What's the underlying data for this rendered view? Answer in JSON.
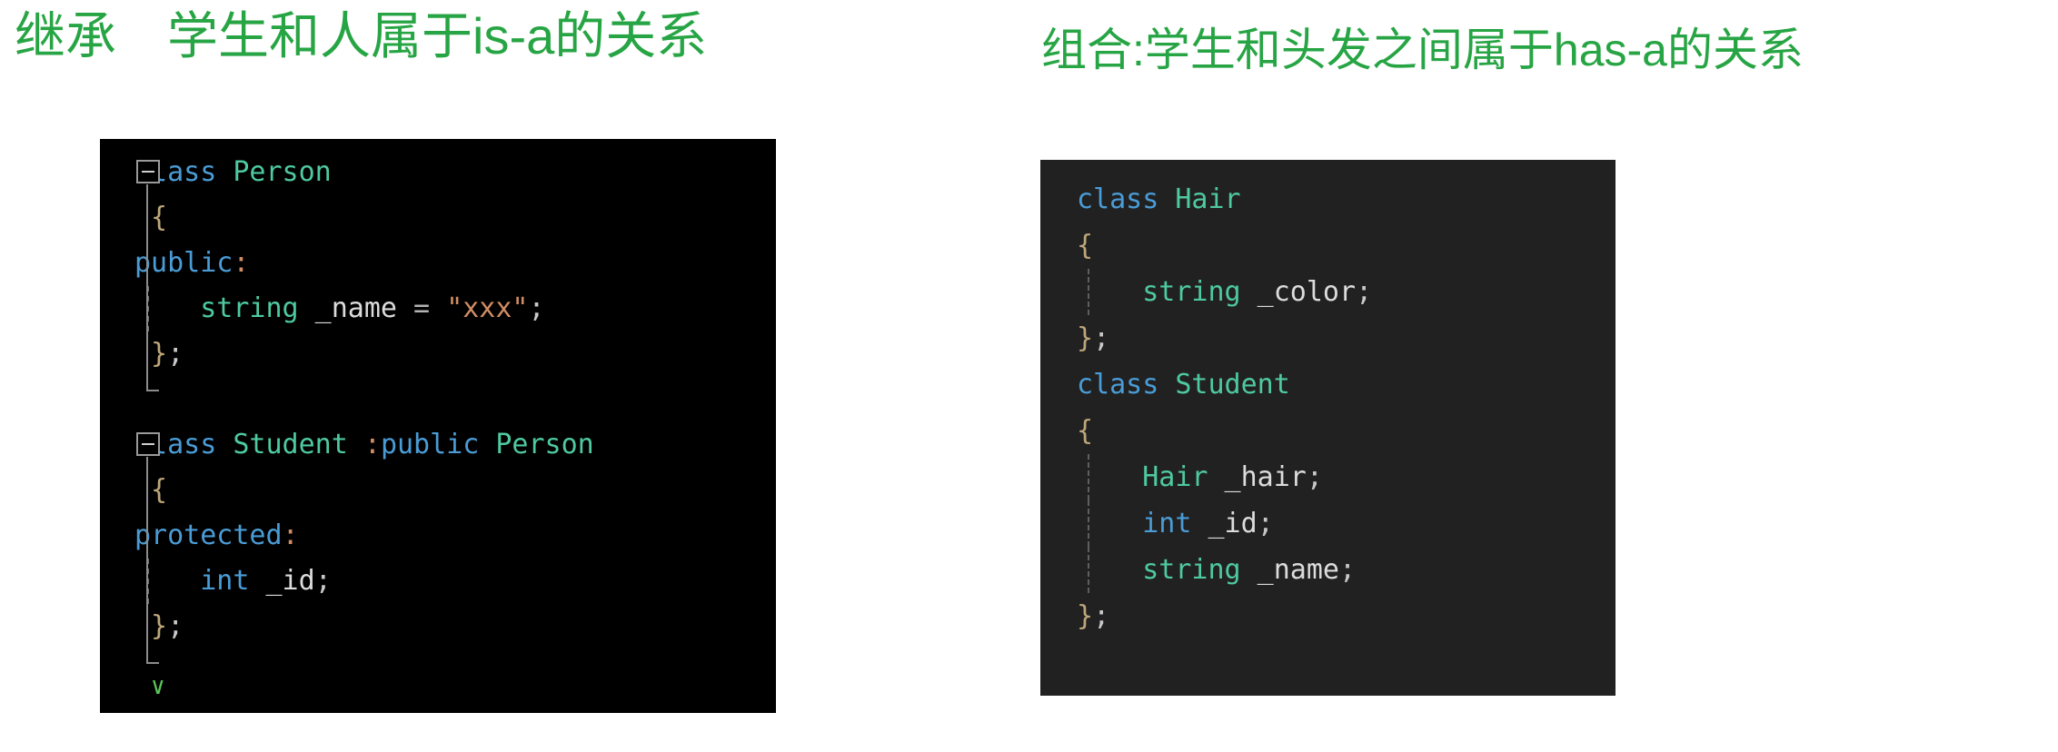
{
  "headings": {
    "left": "继承　学生和人属于is-a的关系",
    "right": "组合:学生和头发之间属于has-a的关系",
    "color": "#27a544"
  },
  "theme": {
    "left_panel_background": "#000000",
    "right_panel_background": "#212121",
    "keyword_color": "#4a9cd6",
    "type_color": "#4ec9a0",
    "identifier_color": "#dcdcdc",
    "string_color": "#d18d63",
    "brace_color": "#bda67a",
    "outline_color": "#8c8c8c",
    "squiggle_color": "#5ac35a"
  },
  "left_code": {
    "language": "cpp",
    "lines": [
      {
        "collapse": "minus",
        "tokens": [
          {
            "t": "class ",
            "c": "kw"
          },
          {
            "t": "Person",
            "c": "type"
          }
        ]
      },
      {
        "tokens": [
          {
            "t": " {",
            "c": "brace"
          }
        ]
      },
      {
        "tokens": [
          {
            "t": "public",
            "c": "kw"
          },
          {
            "t": ":",
            "c": "colon"
          }
        ]
      },
      {
        "indent_guide": true,
        "tokens": [
          {
            "t": "    string",
            "c": "type"
          },
          {
            "t": " _name",
            "c": "ident"
          },
          {
            "t": " = ",
            "c": "op"
          },
          {
            "t": "\"xxx\"",
            "c": "str"
          },
          {
            "t": ";",
            "c": "punct"
          }
        ]
      },
      {
        "tokens": [
          {
            "t": " }",
            "c": "brace"
          },
          {
            "t": ";",
            "c": "punct"
          }
        ]
      },
      {
        "tokens": [
          {
            "t": "",
            "c": "punct"
          }
        ]
      },
      {
        "collapse": "minus",
        "tokens": [
          {
            "t": "class ",
            "c": "kw"
          },
          {
            "t": "Student",
            "c": "type"
          },
          {
            "t": " :",
            "c": "colon"
          },
          {
            "t": "public",
            "c": "kw"
          },
          {
            "t": " ",
            "c": "punct"
          },
          {
            "t": "Person",
            "c": "type"
          }
        ]
      },
      {
        "tokens": [
          {
            "t": " {",
            "c": "brace"
          }
        ]
      },
      {
        "tokens": [
          {
            "t": "protected",
            "c": "kw"
          },
          {
            "t": ":",
            "c": "colon"
          }
        ]
      },
      {
        "indent_guide": true,
        "tokens": [
          {
            "t": "    int",
            "c": "kw"
          },
          {
            "t": " _id",
            "c": "ident"
          },
          {
            "t": ";",
            "c": "punct"
          }
        ]
      },
      {
        "tokens": [
          {
            "t": " }",
            "c": "brace"
          },
          {
            "t": ";",
            "c": "punct"
          }
        ]
      }
    ]
  },
  "right_code": {
    "language": "cpp",
    "lines": [
      {
        "tokens": [
          {
            "t": "class ",
            "c": "kw"
          },
          {
            "t": "Hair",
            "c": "type"
          }
        ]
      },
      {
        "tokens": [
          {
            "t": "{",
            "c": "brace"
          }
        ]
      },
      {
        "indent_guide": true,
        "tokens": [
          {
            "t": "    string",
            "c": "type"
          },
          {
            "t": " _color",
            "c": "ident"
          },
          {
            "t": ";",
            "c": "punct"
          }
        ]
      },
      {
        "tokens": [
          {
            "t": "}",
            "c": "brace"
          },
          {
            "t": ";",
            "c": "punct"
          }
        ]
      },
      {
        "tokens": [
          {
            "t": "class ",
            "c": "kw"
          },
          {
            "t": "Student",
            "c": "type"
          }
        ]
      },
      {
        "tokens": [
          {
            "t": "{",
            "c": "brace"
          }
        ]
      },
      {
        "indent_guide": true,
        "tokens": [
          {
            "t": "    Hair",
            "c": "type"
          },
          {
            "t": " _hair",
            "c": "ident"
          },
          {
            "t": ";",
            "c": "punct"
          }
        ]
      },
      {
        "indent_guide": true,
        "tokens": [
          {
            "t": "    int",
            "c": "kw"
          },
          {
            "t": " _id",
            "c": "ident"
          },
          {
            "t": ";",
            "c": "punct"
          }
        ]
      },
      {
        "indent_guide": true,
        "tokens": [
          {
            "t": "    string",
            "c": "type"
          },
          {
            "t": " _name",
            "c": "ident"
          },
          {
            "t": ";",
            "c": "punct"
          }
        ]
      },
      {
        "tokens": [
          {
            "t": "}",
            "c": "brace"
          },
          {
            "t": ";",
            "c": "punct"
          }
        ]
      }
    ]
  }
}
